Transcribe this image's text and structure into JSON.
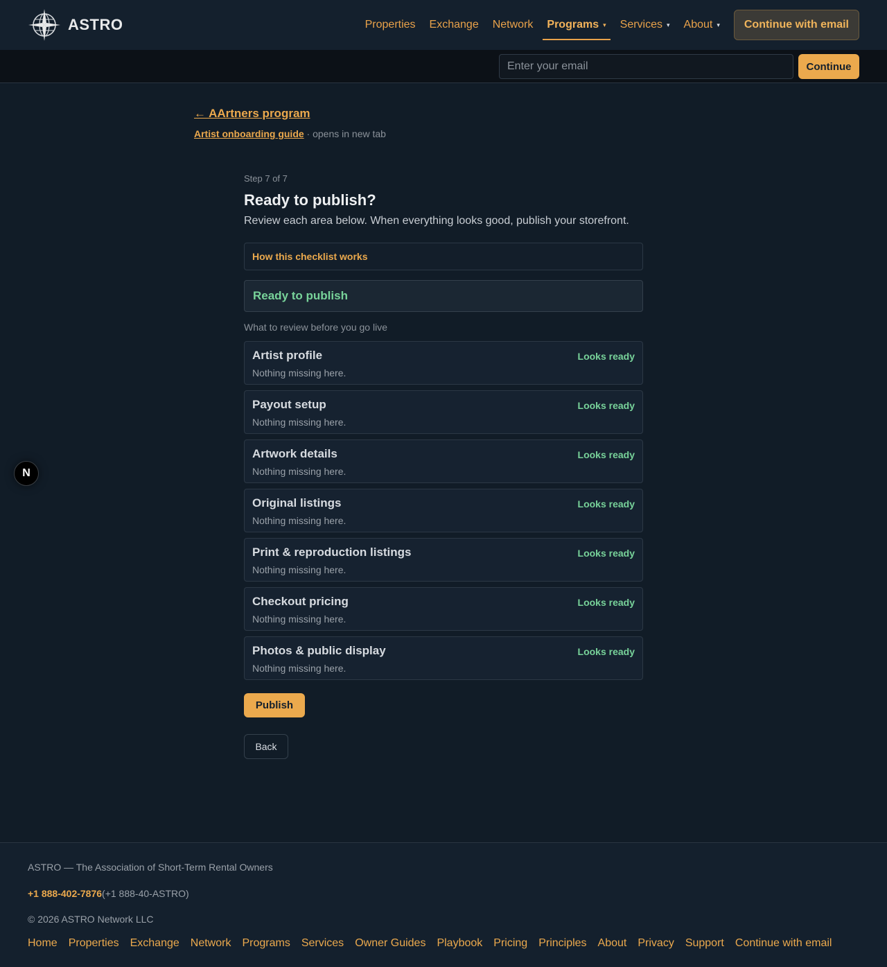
{
  "header": {
    "brand_name": "ASTRO",
    "nav": [
      {
        "label": "Properties"
      },
      {
        "label": "Exchange"
      },
      {
        "label": "Network"
      },
      {
        "label": "Programs",
        "caret": "▾"
      },
      {
        "label": "Services",
        "caret": "▾"
      },
      {
        "label": "About",
        "caret": "▾"
      }
    ],
    "cta_label": "Continue with email",
    "active_nav": "Programs"
  },
  "email_bar": {
    "placeholder": "Enter your email",
    "button_label": "Continue"
  },
  "breadcrumb": {
    "back_label": "← AArtners program",
    "guide_label": "Artist onboarding guide",
    "guide_note": " · opens in new tab"
  },
  "main": {
    "step": "Step 7 of 7",
    "title": "Ready to publish?",
    "subtitle": "Review each area below. When everything looks good, publish your storefront.",
    "how_label": "How this checklist works",
    "ready_label": "Ready to publish",
    "review_label": "What to review before you go live",
    "checklist": [
      {
        "title": "Artist profile",
        "status": "Looks ready",
        "note": "Nothing missing here."
      },
      {
        "title": "Payout setup",
        "status": "Looks ready",
        "note": "Nothing missing here."
      },
      {
        "title": "Artwork details",
        "status": "Looks ready",
        "note": "Nothing missing here."
      },
      {
        "title": "Original listings",
        "status": "Looks ready",
        "note": "Nothing missing here."
      },
      {
        "title": "Print & reproduction listings",
        "status": "Looks ready",
        "note": "Nothing missing here."
      },
      {
        "title": "Checkout pricing",
        "status": "Looks ready",
        "note": "Nothing missing here."
      },
      {
        "title": "Photos & public display",
        "status": "Looks ready",
        "note": "Nothing missing here."
      }
    ],
    "publish_label": "Publish",
    "back_label": "Back"
  },
  "badge": {
    "letter": "N"
  },
  "footer": {
    "org": "ASTRO — The Association of Short-Term Rental Owners",
    "phone": "+1 888-402-7876",
    "phone_alt": "(+1 888-40-ASTRO)",
    "copyright": "© 2026 ASTRO Network LLC",
    "links": [
      "Home",
      "Properties",
      "Exchange",
      "Network",
      "Programs",
      "Services",
      "Owner Guides",
      "Playbook",
      "Pricing",
      "Principles",
      "About",
      "Privacy",
      "Support",
      "Continue with email"
    ]
  },
  "colors": {
    "accent": "#eba94d",
    "success": "#78d39a",
    "background": "#111c27"
  }
}
